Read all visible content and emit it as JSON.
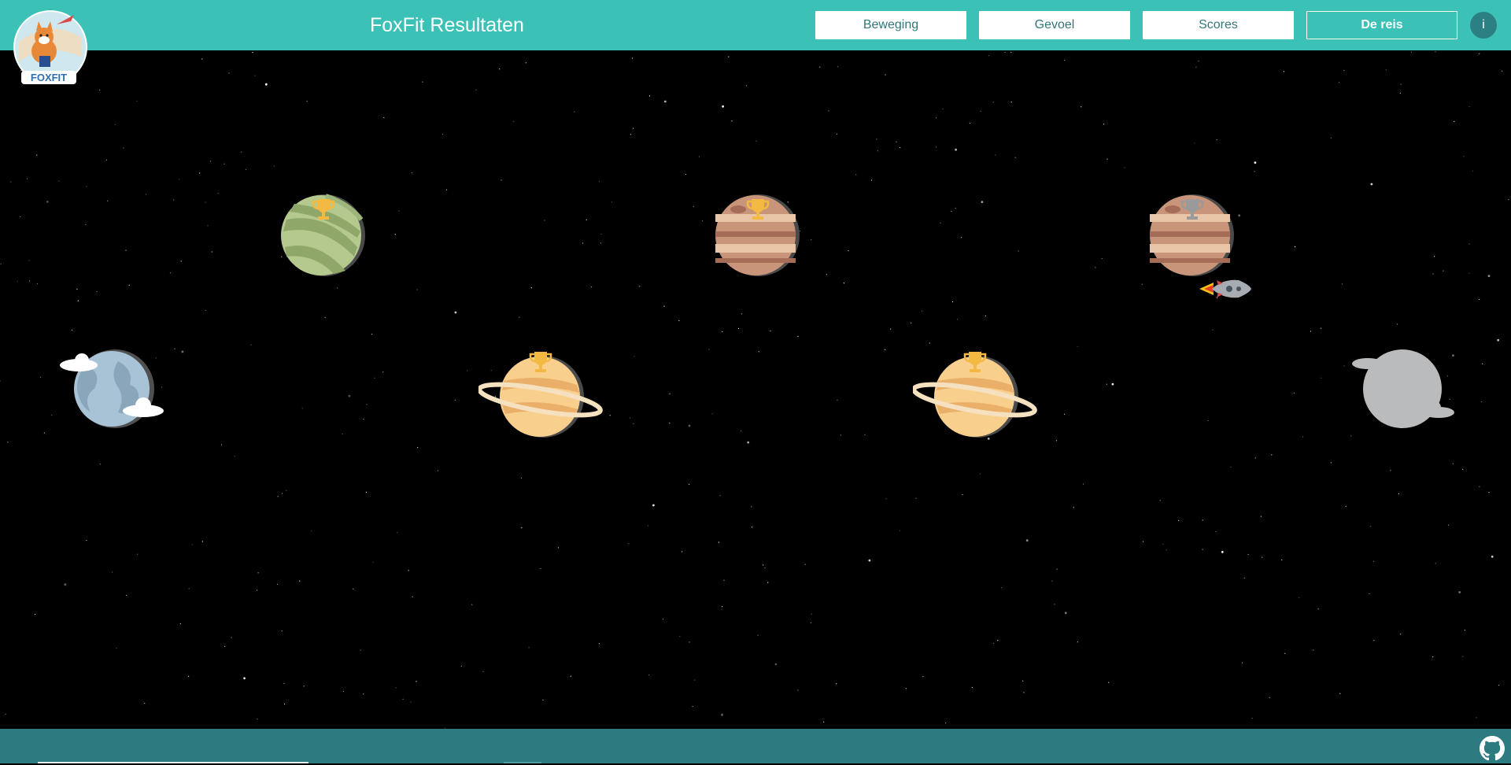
{
  "header": {
    "title": "FoxFit Resultaten",
    "logo_text": "FOXFIT",
    "nav": [
      {
        "label": "Beweging",
        "active": false
      },
      {
        "label": "Gevoel",
        "active": false
      },
      {
        "label": "Scores",
        "active": false
      },
      {
        "label": "De reis",
        "active": true
      }
    ],
    "info_label": "i"
  },
  "journey": {
    "stages": [
      {
        "name": "earth",
        "trophy": "none"
      },
      {
        "name": "green-planet",
        "trophy": "gold"
      },
      {
        "name": "ringed-planet-1",
        "trophy": "gold"
      },
      {
        "name": "jupiter-1",
        "trophy": "gold"
      },
      {
        "name": "ringed-planet-2",
        "trophy": "gold"
      },
      {
        "name": "jupiter-2",
        "trophy": "silver",
        "rocket": true
      },
      {
        "name": "locked-planet",
        "trophy": "none"
      }
    ]
  },
  "colors": {
    "header": "#3cc1b6",
    "footer": "#2d7a80",
    "gold": "#f4b942",
    "silver": "#9a9a9a"
  },
  "footer": {
    "icon": "github-icon"
  }
}
